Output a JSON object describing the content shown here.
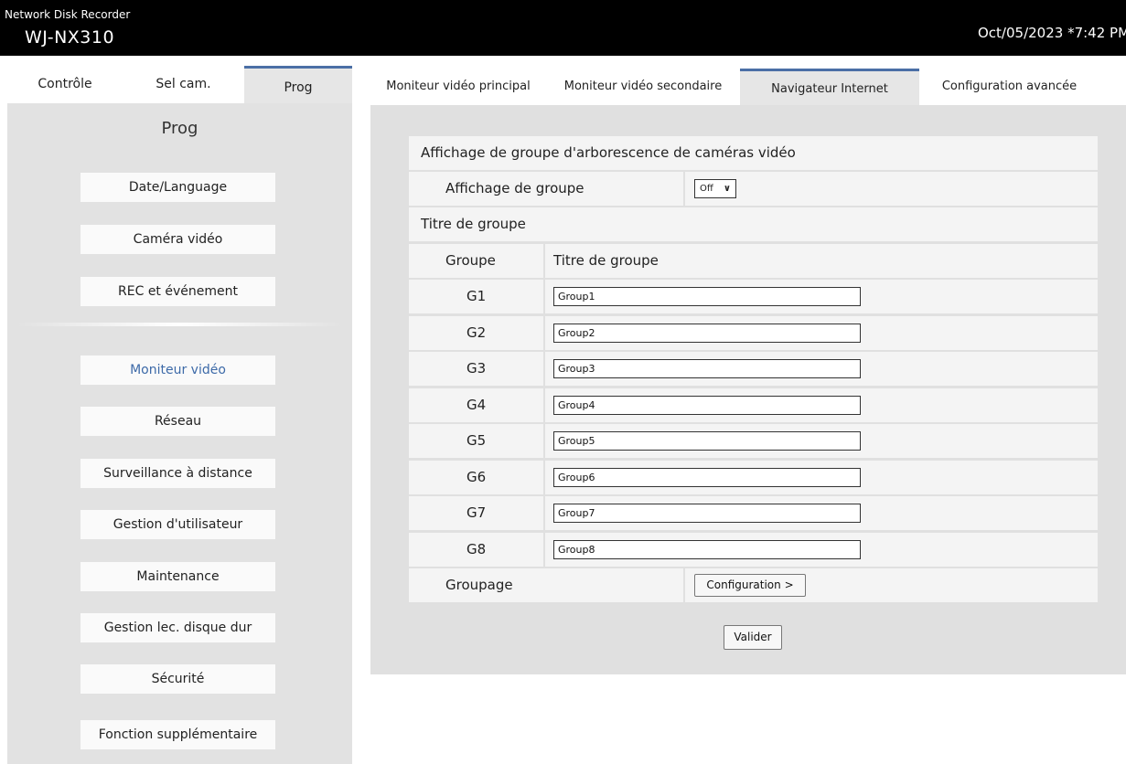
{
  "header": {
    "brand": "Network Disk Recorder",
    "model": "WJ-NX310",
    "datetime": "Oct/05/2023 *7:42 PM"
  },
  "left_tabs": [
    "Contrôle",
    "Sel cam.",
    "Prog"
  ],
  "sidebar": {
    "title": "Prog",
    "items": [
      "Date/Language",
      "Caméra vidéo",
      "REC et événement",
      "Moniteur vidéo",
      "Réseau",
      "Surveillance à distance",
      "Gestion d'utilisateur",
      "Maintenance",
      "Gestion lec. disque dur",
      "Sécurité",
      "Fonction supplémentaire"
    ]
  },
  "right_tabs": [
    "Moniteur vidéo principal",
    "Moniteur vidéo secondaire",
    "Navigateur Internet",
    "Configuration avancée"
  ],
  "form": {
    "section_title": "Affichage de groupe d'arborescence de caméras vidéo",
    "group_display_label": "Affichage de groupe",
    "group_display_value": "Off",
    "group_title_section": "Titre de groupe",
    "col_group": "Groupe",
    "col_title": "Titre de groupe",
    "groups": [
      {
        "id": "G1",
        "title": "Group1"
      },
      {
        "id": "G2",
        "title": "Group2"
      },
      {
        "id": "G3",
        "title": "Group3"
      },
      {
        "id": "G4",
        "title": "Group4"
      },
      {
        "id": "G5",
        "title": "Group5"
      },
      {
        "id": "G6",
        "title": "Group6"
      },
      {
        "id": "G7",
        "title": "Group7"
      },
      {
        "id": "G8",
        "title": "Group8"
      }
    ],
    "grouping_label": "Groupage",
    "config_button": "Configuration >",
    "submit_button": "Valider"
  },
  "colors": {
    "accent": "#4b6fa6",
    "current_item": "#3d6aa8",
    "header_bg": "#000000",
    "panel_bg": "#e0e0e0"
  }
}
